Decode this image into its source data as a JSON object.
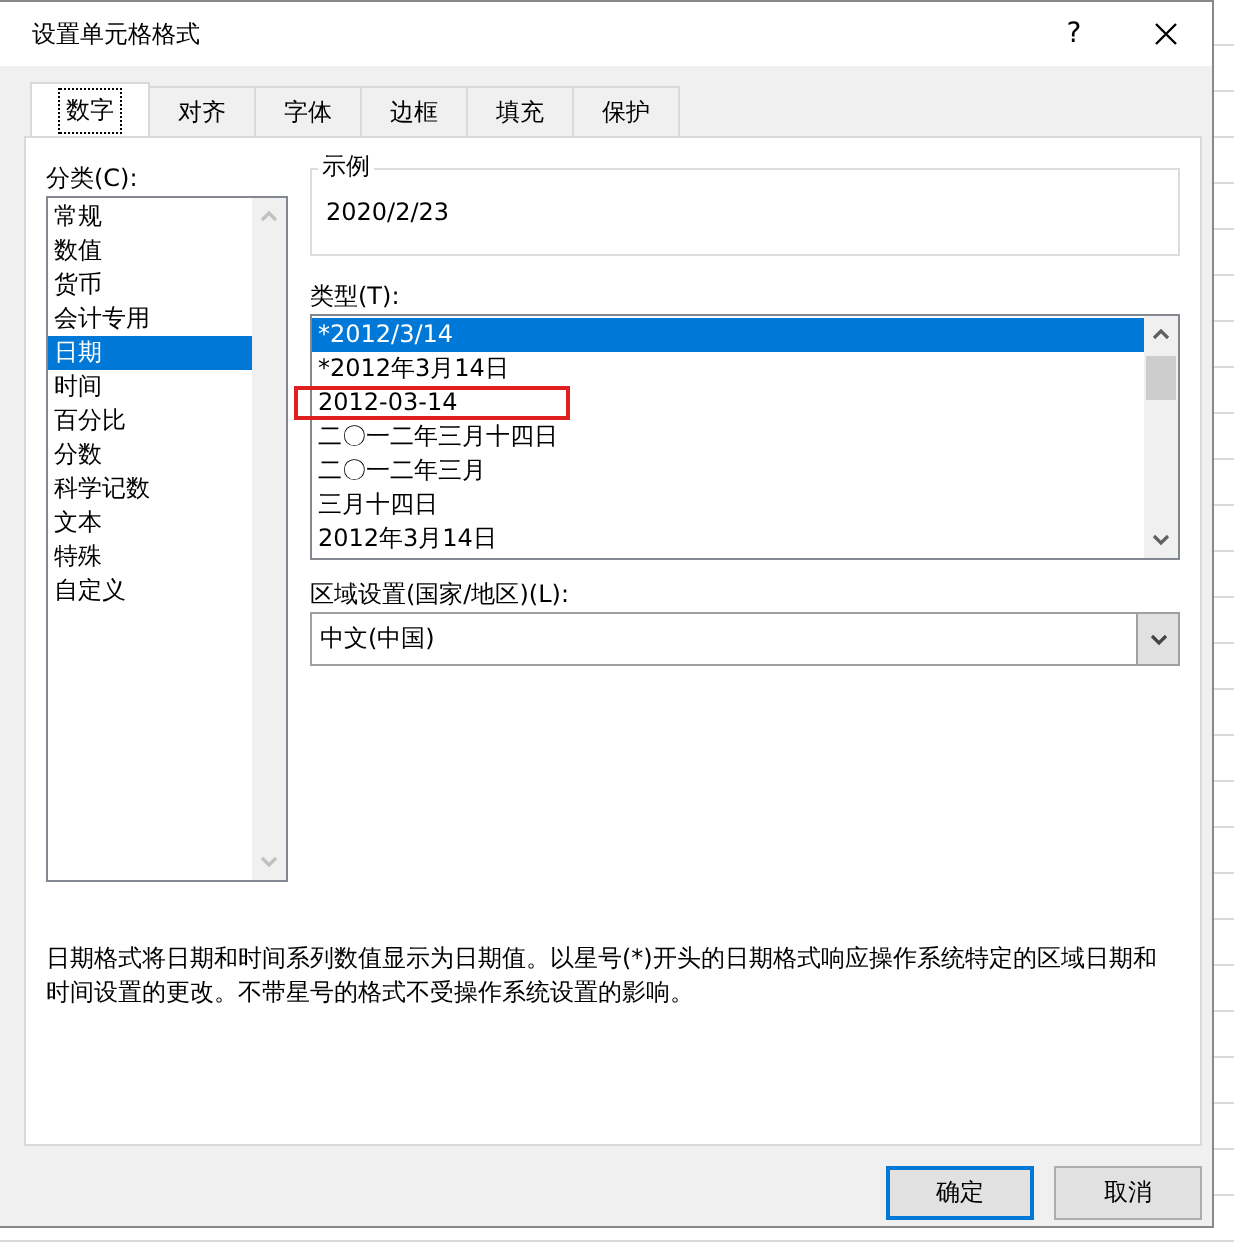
{
  "window": {
    "title": "设置单元格格式",
    "help": "?"
  },
  "tabs": [
    {
      "label": "数字",
      "selected": true
    },
    {
      "label": "对齐",
      "selected": false
    },
    {
      "label": "字体",
      "selected": false
    },
    {
      "label": "边框",
      "selected": false
    },
    {
      "label": "填充",
      "selected": false
    },
    {
      "label": "保护",
      "selected": false
    }
  ],
  "category": {
    "label": "分类(C):",
    "items": [
      {
        "label": "常规",
        "selected": false
      },
      {
        "label": "数值",
        "selected": false
      },
      {
        "label": "货币",
        "selected": false
      },
      {
        "label": "会计专用",
        "selected": false
      },
      {
        "label": "日期",
        "selected": true
      },
      {
        "label": "时间",
        "selected": false
      },
      {
        "label": "百分比",
        "selected": false
      },
      {
        "label": "分数",
        "selected": false
      },
      {
        "label": "科学记数",
        "selected": false
      },
      {
        "label": "文本",
        "selected": false
      },
      {
        "label": "特殊",
        "selected": false
      },
      {
        "label": "自定义",
        "selected": false
      }
    ]
  },
  "sample": {
    "label": "示例",
    "value": "2020/2/23"
  },
  "type": {
    "label": "类型(T):",
    "items": [
      {
        "label": "*2012/3/14",
        "selected": true,
        "boxed": false
      },
      {
        "label": "*2012年3月14日",
        "selected": false,
        "boxed": false
      },
      {
        "label": "2012-03-14",
        "selected": false,
        "boxed": true
      },
      {
        "label": "二〇一二年三月十四日",
        "selected": false,
        "boxed": false
      },
      {
        "label": "二〇一二年三月",
        "selected": false,
        "boxed": false
      },
      {
        "label": "三月十四日",
        "selected": false,
        "boxed": false
      },
      {
        "label": "2012年3月14日",
        "selected": false,
        "boxed": false
      }
    ]
  },
  "locale": {
    "label": "区域设置(国家/地区)(L):",
    "value": "中文(中国)"
  },
  "description": "日期格式将日期和时间系列数值显示为日期值。以星号(*)开头的日期格式响应操作系统特定的区域日期和时间设置的更改。不带星号的格式不受操作系统设置的影响。",
  "buttons": [
    {
      "label": "确定",
      "default": true
    },
    {
      "label": "取消",
      "default": false
    }
  ]
}
